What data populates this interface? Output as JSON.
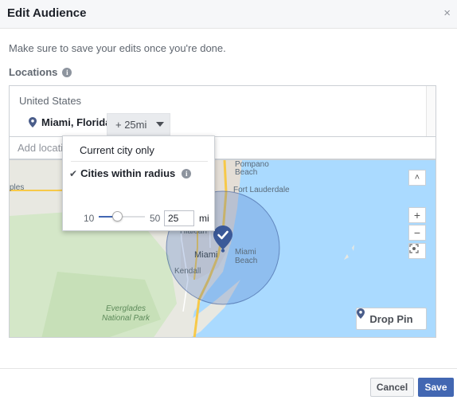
{
  "dialog": {
    "title": "Edit Audience",
    "close_glyph": "×",
    "subtitle": "Make sure to save your edits once you're done."
  },
  "locations": {
    "label": "Locations",
    "info_glyph": "i",
    "country": "United States",
    "selected_place": "Miami, Florida",
    "radius_label": "+ 25mi",
    "add_placeholder": "Add locations"
  },
  "radius_popup": {
    "option_current_city": "Current city only",
    "option_within_radius": "Cities within radius",
    "selected_option": "Cities within radius",
    "check_glyph": "✔",
    "info_glyph": "i",
    "slider_min": "10",
    "slider_max": "50",
    "slider_value": 25,
    "value": "25",
    "unit": "mi"
  },
  "map": {
    "labels": {
      "naples": "ples",
      "pompano": "Pompano",
      "beach1": "Beach",
      "fort_lauderdale": "Fort Lauderdale",
      "hialeah": "Hialeah",
      "miami": "Miami",
      "miami_beach": "Miami",
      "beach2": "Beach",
      "kendall": "Kendall",
      "everglades1": "Everglades",
      "everglades2": "National Park"
    },
    "zoom_in": "+",
    "zoom_out": "−",
    "collapse": "˄",
    "drop_pin_label": "Drop Pin",
    "colors": {
      "water": "#aadaff",
      "land": "#e8e8e1",
      "park": "#cde6c1",
      "highway": "#f7c948",
      "radius_fill": "#4b75c4",
      "pin": "#3b5998"
    }
  },
  "footer": {
    "cancel_label": "Cancel",
    "save_label": "Save"
  }
}
